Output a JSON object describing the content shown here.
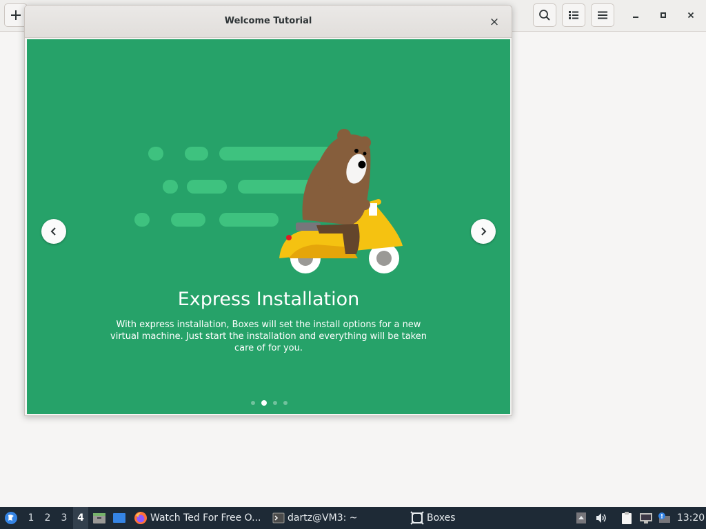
{
  "app": {
    "header_buttons": {
      "new_icon": "plus-icon",
      "search_icon": "search-icon",
      "view_icon": "list-view-icon",
      "menu_icon": "hamburger-menu-icon"
    },
    "window_controls": [
      "minimize-icon",
      "maximize-icon",
      "close-icon"
    ]
  },
  "dialog": {
    "title": "Welcome Tutorial",
    "close_glyph": "×",
    "slide": {
      "heading": "Express Installation",
      "body": "With express installation, Boxes will set the install options for a new virtual machine. Just start the installation and everything will be taken care of for you.",
      "illustration": "bear-riding-scooter",
      "page_count": 4,
      "current_page": 2
    },
    "prev_glyph": "‹",
    "next_glyph": "›"
  },
  "colors": {
    "slide_bg": "#26a269",
    "scooter": "#f5c211",
    "bear": "#865e3c",
    "taskbar_bg": "#1e2a36"
  },
  "taskbar": {
    "workspaces": [
      "1",
      "2",
      "3",
      "4"
    ],
    "active_workspace": "4",
    "tasks": [
      {
        "label": "Watch Ted For Free O...",
        "icon": "firefox-icon"
      },
      {
        "label": "dartz@VM3: ~",
        "icon": "terminal-icon"
      },
      {
        "label": "Boxes",
        "icon": "boxes-icon"
      }
    ],
    "clock": "13:20"
  }
}
